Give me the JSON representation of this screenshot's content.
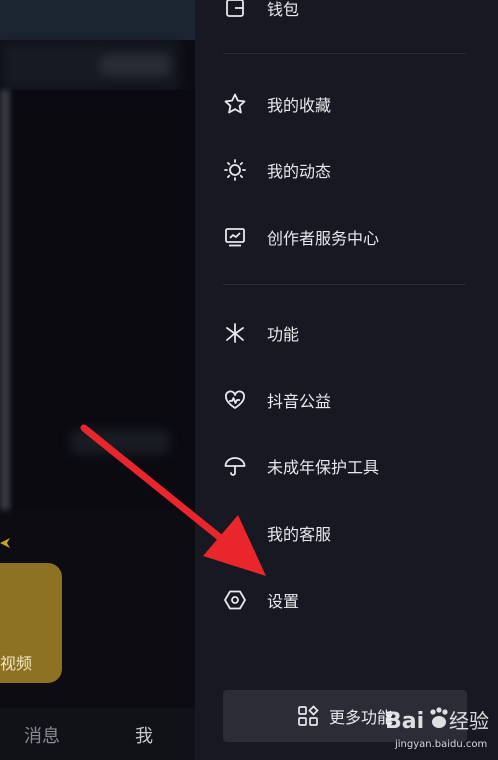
{
  "background": {
    "gold_card_text": "视频",
    "tabs": [
      {
        "label": "消息"
      },
      {
        "label": "我"
      }
    ]
  },
  "drawer": {
    "items_top": [
      {
        "label": "钱包",
        "icon": "wallet-icon"
      }
    ],
    "items_section1": [
      {
        "label": "我的收藏",
        "icon": "star-icon"
      },
      {
        "label": "我的动态",
        "icon": "sun-icon"
      },
      {
        "label": "创作者服务中心",
        "icon": "monitor-chart-icon"
      }
    ],
    "items_section2": [
      {
        "label": "功能",
        "icon": "sparkle-icon"
      },
      {
        "label": "抖音公益",
        "icon": "heart-pulse-icon"
      },
      {
        "label": "未成年保护工具",
        "icon": "umbrella-icon"
      },
      {
        "label": "我的客服",
        "icon": "headset-icon"
      },
      {
        "label": "设置",
        "icon": "hexagon-settings-icon"
      }
    ],
    "more_button": {
      "label": "更多功能",
      "icon": "grid-diamond-icon"
    }
  },
  "watermark": {
    "brand": "Bai du 经验",
    "url": "jingyan.baidu.com"
  },
  "colors": {
    "drawer_bg": "#171822",
    "text": "#e8e8ec",
    "arrow": "#e8262b",
    "gold": "#8d7223"
  }
}
